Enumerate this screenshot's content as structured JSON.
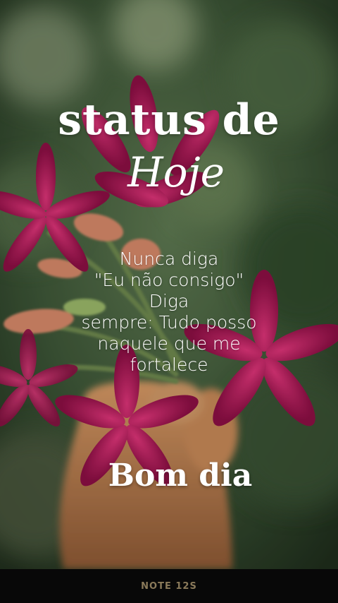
{
  "image": {
    "description_icon": "pink-flowers-in-hand-photo",
    "colors": {
      "background_green": "#3f5a3a",
      "flower_magenta": "#b0195a",
      "skin": "#c88a5a",
      "bar": "#080808",
      "watermark": "#8a7a5a"
    }
  },
  "overlay": {
    "title_line1": "status de",
    "title_line2": "Hoje",
    "quote_lines": [
      "Nunca diga",
      "\"Eu não consigo\"",
      "Diga",
      "sempre: Tudo posso",
      "naquele que me",
      "fortalece"
    ],
    "closing": "Bom dia"
  },
  "device": {
    "watermark": "NOTE 12S"
  }
}
